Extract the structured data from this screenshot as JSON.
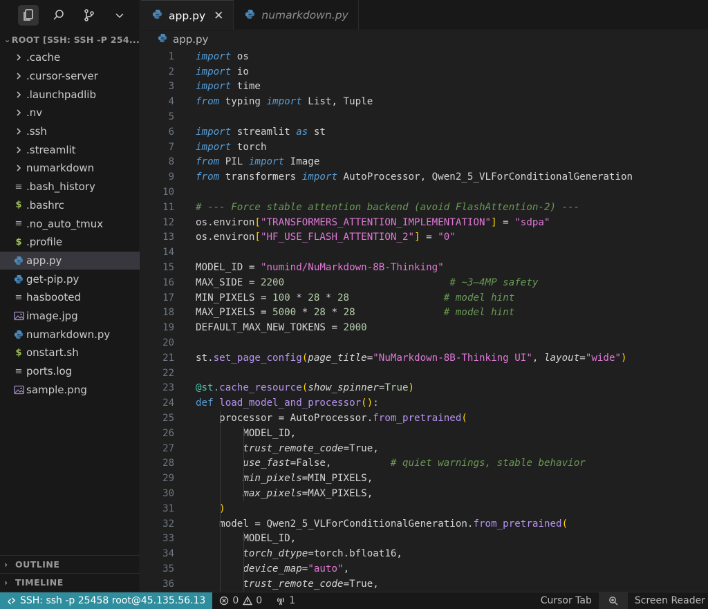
{
  "sidebar": {
    "root_label": "ROOT [SSH: SSH -P 254...",
    "items": [
      {
        "label": ".cache",
        "type": "folder"
      },
      {
        "label": ".cursor-server",
        "type": "folder"
      },
      {
        "label": ".launchpadlib",
        "type": "folder"
      },
      {
        "label": ".nv",
        "type": "folder"
      },
      {
        "label": ".ssh",
        "type": "folder"
      },
      {
        "label": ".streamlit",
        "type": "folder"
      },
      {
        "label": "numarkdown",
        "type": "folder"
      },
      {
        "label": ".bash_history",
        "type": "text"
      },
      {
        "label": ".bashrc",
        "type": "shell"
      },
      {
        "label": ".no_auto_tmux",
        "type": "text"
      },
      {
        "label": ".profile",
        "type": "shell"
      },
      {
        "label": "app.py",
        "type": "python",
        "selected": true
      },
      {
        "label": "get-pip.py",
        "type": "python"
      },
      {
        "label": "hasbooted",
        "type": "text"
      },
      {
        "label": "image.jpg",
        "type": "image"
      },
      {
        "label": "numarkdown.py",
        "type": "python"
      },
      {
        "label": "onstart.sh",
        "type": "shell"
      },
      {
        "label": "ports.log",
        "type": "text"
      },
      {
        "label": "sample.png",
        "type": "image"
      }
    ],
    "outline_label": "OUTLINE",
    "timeline_label": "TIMELINE"
  },
  "tabs": [
    {
      "label": "app.py",
      "active": true
    },
    {
      "label": "numarkdown.py",
      "active": false
    }
  ],
  "breadcrumb": "app.py",
  "editor": {
    "line_numbers": [
      "1",
      "2",
      "3",
      "4",
      "5",
      "6",
      "7",
      "8",
      "9",
      "10",
      "11",
      "12",
      "13",
      "14",
      "15",
      "16",
      "17",
      "18",
      "19",
      "20",
      "21",
      "22",
      "23",
      "24",
      "25",
      "26",
      "27",
      "28",
      "29",
      "30",
      "31",
      "32",
      "33",
      "34",
      "35",
      "36"
    ]
  },
  "status": {
    "remote": "SSH: ssh -p 25458 root@45.135.56.13",
    "errors": "0",
    "warnings": "0",
    "ports": "1",
    "cursor_tab": "Cursor Tab",
    "screen_reader": "Screen Reader"
  }
}
